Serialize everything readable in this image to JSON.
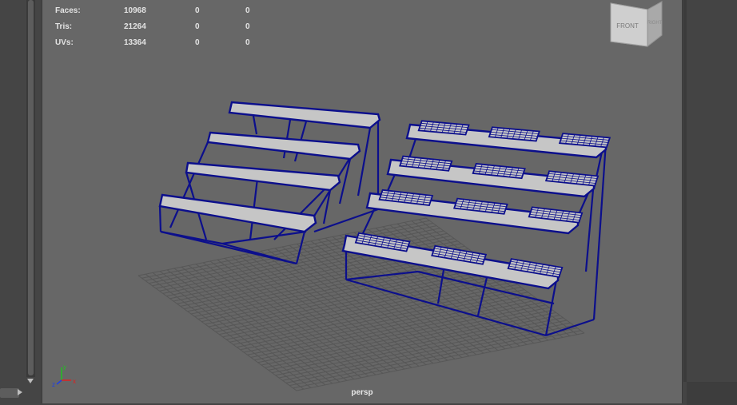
{
  "hud": {
    "rows": [
      {
        "label": "Faces:",
        "values": [
          "10968",
          "0",
          "0"
        ]
      },
      {
        "label": "Tris:",
        "values": [
          "21264",
          "0",
          "0"
        ]
      },
      {
        "label": "UVs:",
        "values": [
          "13364",
          "0",
          "0"
        ]
      }
    ]
  },
  "viewport": {
    "camera_label": "persp",
    "background_color": "#676767",
    "wireframe_color": "#0c0f8c",
    "surface_color": "#c6c6c6"
  },
  "view_cube": {
    "front_label": "FRONT",
    "right_label": "RIGHT"
  },
  "axis_gizmo": {
    "x_label": "x",
    "y_label": "y",
    "z_label": "z",
    "x_color": "#e02020",
    "y_color": "#20c020",
    "z_color": "#2040e0"
  },
  "icons": [
    "scroll-down-arrow-icon",
    "scroll-right-arrow-icon",
    "view-cube-icon",
    "axis-gizmo-icon"
  ]
}
